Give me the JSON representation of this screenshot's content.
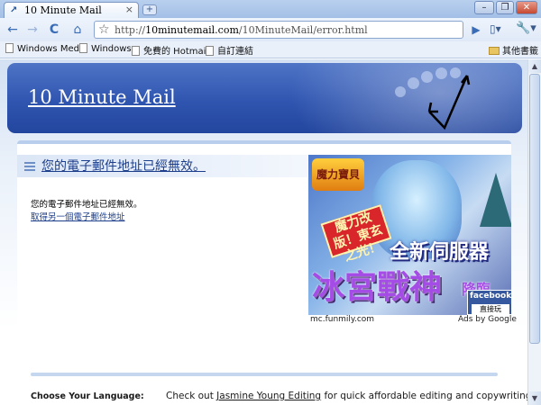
{
  "browser": {
    "tab_title": "10 Minute Mail",
    "tab_close": "×",
    "new_tab": "+",
    "url_domain": "10minutemail.com",
    "url_prefix": "http://",
    "url_path": "/10MinuteMail/error.html",
    "buttons": {
      "back": "←",
      "forward": "→",
      "reload": "C",
      "home": "⌂",
      "go": "▶",
      "page_menu": "▾",
      "wrench_menu": "▾"
    },
    "window": {
      "minimize": "–",
      "restore": "❐",
      "close": "✕"
    },
    "bookmarks": [
      "Windows Media",
      "Windows",
      "免費的 Hotmail",
      "自訂連結"
    ],
    "other_bookmarks": "其他書籤"
  },
  "page": {
    "site_title": "10 Minute Mail",
    "heading": "您的電子郵件地址已經無效。",
    "message": "您的電子郵件地址已經無效。",
    "new_address_link": "取得另一個電子郵件地址",
    "ad": {
      "logo_text": "魔力寶貝",
      "banner_red": "魔力改版！東玄之光！",
      "server_text": "全新伺服器",
      "big_text": "冰宮戰神",
      "side_text": "降臨",
      "facebook": "facebook",
      "facebook_sub": "直接玩",
      "source": "mc.funmily.com",
      "by": "Ads by Google"
    },
    "language_label": "Choose Your Language:",
    "checkout_prefix": "Check out ",
    "checkout_link": "Jasmine Young Editing",
    "checkout_suffix": " for quick affordable editing and copywriting!"
  },
  "colors": {
    "banner": "#2f55b0",
    "heading": "#1d3e8a",
    "page_bg": "#d3e1f3"
  }
}
